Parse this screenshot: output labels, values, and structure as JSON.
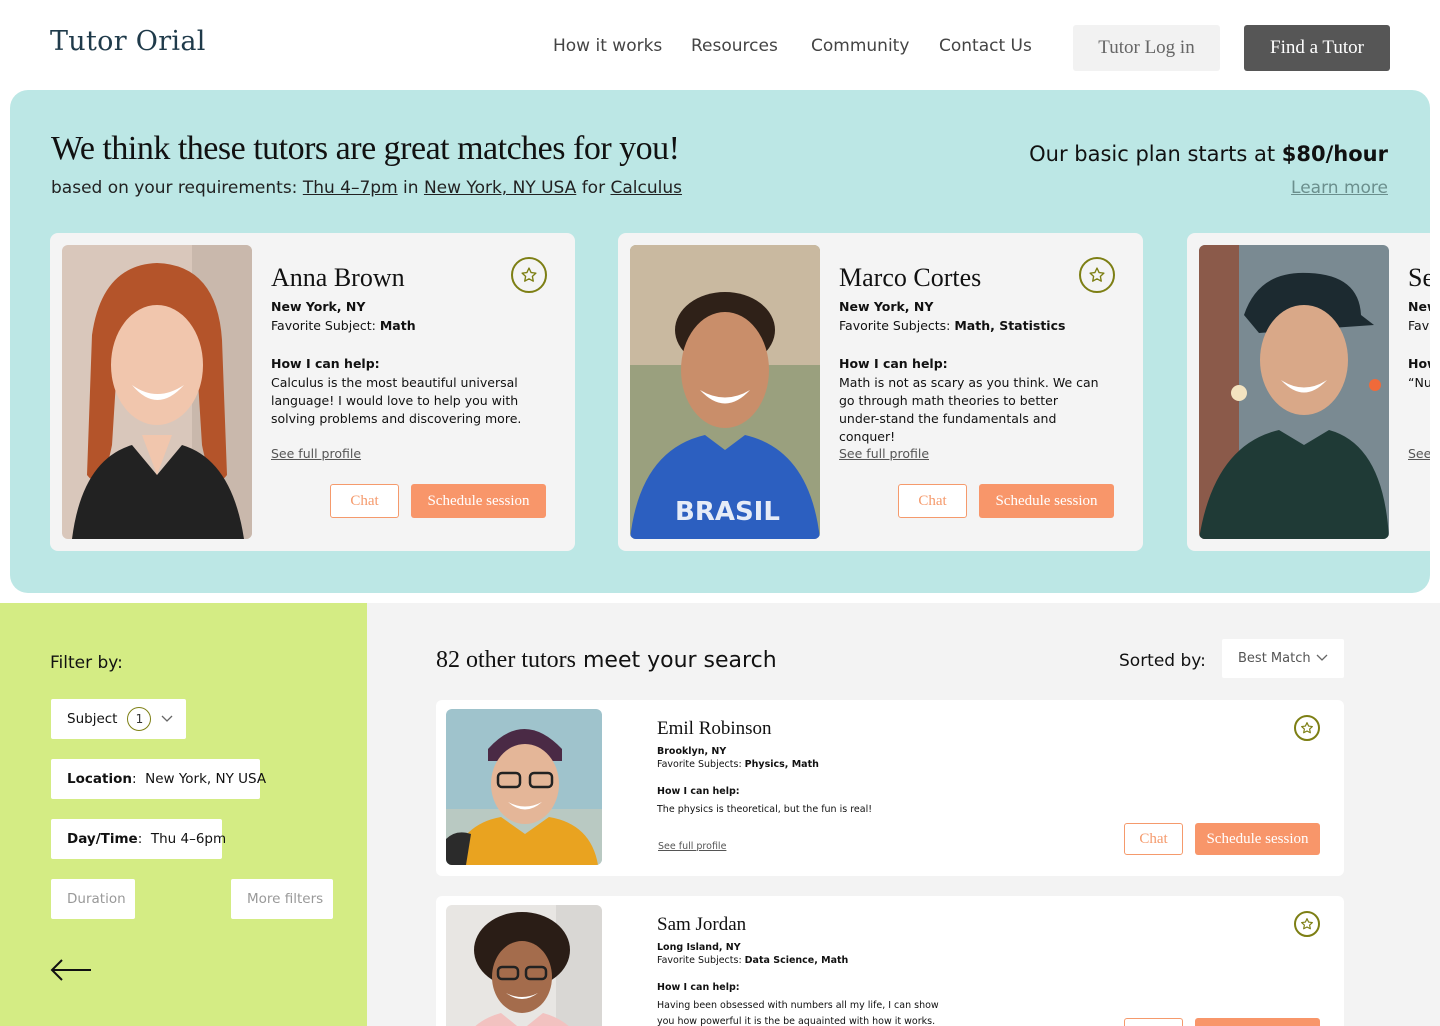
{
  "header": {
    "logo": "Tutor Orial",
    "nav": [
      "How it works",
      "Resources",
      "Community",
      "Contact Us"
    ],
    "login_label": "Tutor Log in",
    "find_label": "Find a Tutor"
  },
  "hero": {
    "title": "We think these tutors are great matches for you!",
    "sub_prefix": "based on your requirements: ",
    "sub_time": "Thu 4–7pm",
    "sub_in": " in ",
    "sub_location": "New York, NY USA",
    "sub_for": " for ",
    "sub_subject": "Calculus",
    "plan_prefix": "Our basic plan starts at ",
    "plan_price": "$80/hour",
    "learn_more": "Learn more"
  },
  "featured": [
    {
      "name": "Anna Brown",
      "location": "New York, NY",
      "subject_label": "Favorite Subject: ",
      "subjects": "Math",
      "help_heading": "How I can help:",
      "help": "Calculus is the most beautiful universal language! I would love to help you with solving problems and discovering more.",
      "full_profile": "See full profile",
      "chat": "Chat",
      "schedule": "Schedule session"
    },
    {
      "name": "Marco Cortes",
      "location": "New York, NY",
      "subject_label": "Favorite Subjects: ",
      "subjects": "Math, Statistics",
      "help_heading": "How I can help:",
      "help": "Math is not as scary as you think. We can go through math theories to better under-stand the fundamentals and conquer!",
      "full_profile": "See full profile",
      "chat": "Chat",
      "schedule": "Schedule session"
    },
    {
      "name": "Se",
      "location": "New",
      "subject_label": "Fav",
      "subjects": "",
      "help_heading": "How",
      "help": "“Nu",
      "full_profile": "See"
    }
  ],
  "filters": {
    "label": "Filter by:",
    "subject": "Subject",
    "subject_count": "1",
    "location_key": "Location",
    "location_value": "New York, NY USA",
    "daytime_key": "Day/Time",
    "daytime_value": "Thu 4–6pm",
    "duration": "Duration",
    "more": "More filters"
  },
  "results": {
    "count_serif": "82 other tutors",
    "count_rest": " meet your search",
    "sorted_label": "Sorted by:",
    "sort_value": "Best Match",
    "rows": [
      {
        "name": "Emil Robinson",
        "location": "Brooklyn, NY",
        "subject_label": "Favorite Subjects: ",
        "subjects": "Physics, Math",
        "help_heading": "How I can help:",
        "help": "The physics is theoretical, but the fun is real!",
        "full_profile": "See full profile",
        "chat": "Chat",
        "schedule": "Schedule session"
      },
      {
        "name": "Sam Jordan",
        "location": "Long Island, NY",
        "subject_label": "Favorite Subjects: ",
        "subjects": "Data Science, Math",
        "help_heading": "How I can help:",
        "help": "Having been obsessed with numbers all my life, I can show you how powerful it is the be aquainted with how it works."
      }
    ]
  },
  "colors": {
    "hero_bg": "#bce7e5",
    "sidebar_bg": "#d4ec84",
    "accent_orange": "#f8966a",
    "star_olive": "#7d7f14",
    "dark_button": "#565656"
  }
}
